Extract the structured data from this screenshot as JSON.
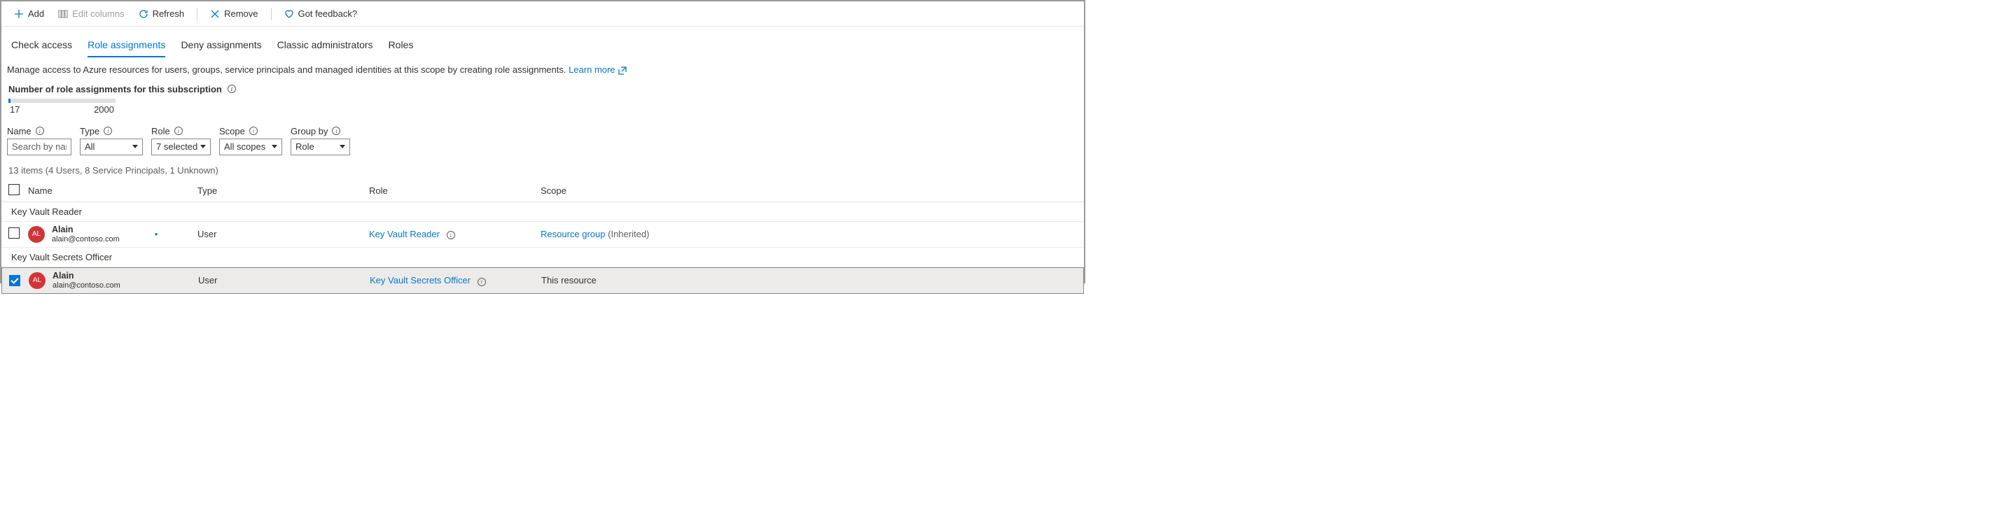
{
  "toolbar": {
    "add": "Add",
    "edit_columns": "Edit columns",
    "refresh": "Refresh",
    "remove": "Remove",
    "feedback": "Got feedback?"
  },
  "tabs": {
    "check_access": "Check access",
    "role_assignments": "Role assignments",
    "deny_assignments": "Deny assignments",
    "classic_admins": "Classic administrators",
    "roles": "Roles"
  },
  "description": {
    "text": "Manage access to Azure resources for users, groups, service principals and managed identities at this scope by creating role assignments. ",
    "learn_more": "Learn more"
  },
  "usage": {
    "title": "Number of role assignments for this subscription",
    "current": "17",
    "max": "2000",
    "fill_percent": 2
  },
  "filters": {
    "name_label": "Name",
    "name_placeholder": "Search by name or email",
    "type_label": "Type",
    "type_value": "All",
    "role_label": "Role",
    "role_value": "7 selected",
    "scope_label": "Scope",
    "scope_value": "All scopes",
    "group_by_label": "Group by",
    "group_by_value": "Role"
  },
  "items_count": "13 items (4 Users, 8 Service Principals, 1 Unknown)",
  "columns": {
    "name": "Name",
    "type": "Type",
    "role": "Role",
    "scope": "Scope"
  },
  "groups": [
    {
      "title": "Key Vault Reader",
      "rows": [
        {
          "selected": false,
          "avatar": "AL",
          "user_name": "Alain",
          "user_email": "alain@contoso.com",
          "type": "User",
          "role": "Key Vault Reader",
          "scope_link": "Resource group",
          "scope_suffix": "(Inherited)"
        }
      ]
    },
    {
      "title": "Key Vault Secrets Officer",
      "rows": [
        {
          "selected": true,
          "avatar": "AL",
          "user_name": "Alain",
          "user_email": "alain@contoso.com",
          "type": "User",
          "role": "Key Vault Secrets Officer",
          "scope_text": "This resource"
        }
      ]
    }
  ]
}
